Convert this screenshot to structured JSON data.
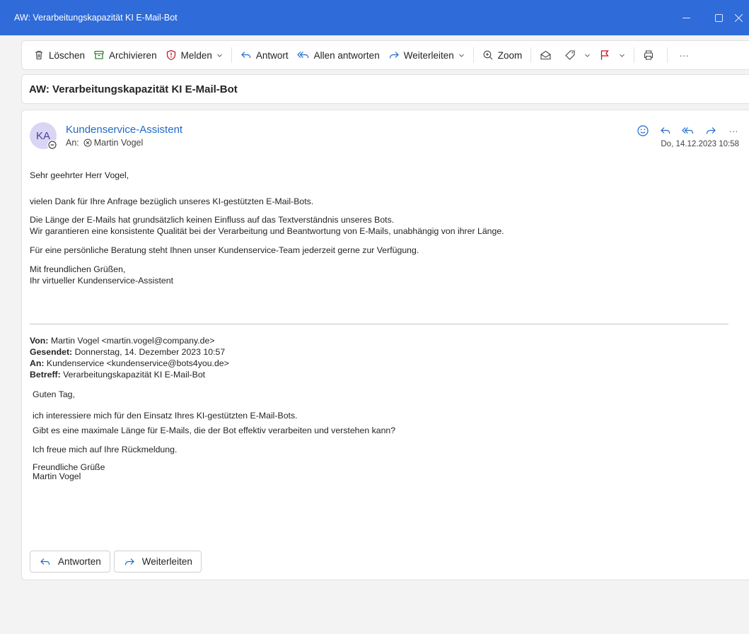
{
  "window": {
    "title": "AW: Verarbeitungskapazität KI E-Mail-Bot"
  },
  "toolbar": {
    "delete": "Löschen",
    "archive": "Archivieren",
    "report": "Melden",
    "reply": "Antwort",
    "reply_all": "Allen antworten",
    "forward": "Weiterleiten",
    "zoom": "Zoom",
    "more": "···"
  },
  "message": {
    "subject": "AW: Verarbeitungskapazität KI E-Mail-Bot",
    "avatar_initials": "KA",
    "sender": "Kundenservice-Assistent",
    "to_label": "An:",
    "recipient": "Martin Vogel",
    "date": "Do, 14.12.2023 10:58",
    "more": "···",
    "body": [
      "Sehr geehrter Herr Vogel,",
      "vielen Dank für Ihre Anfrage bezüglich unseres KI-gestützten E-Mail-Bots.",
      "Die Länge der E-Mails hat grundsätzlich keinen Einfluss auf das Textverständnis unseres Bots.",
      "Wir garantieren eine konsistente Qualität bei der Verarbeitung und Beantwortung von E-Mails, unabhängig von ihrer Länge.",
      "Für eine persönliche Beratung steht Ihnen unser Kundenservice-Team jederzeit gerne zur Verfügung.",
      "Mit freundlichen Grüßen,",
      "Ihr virtueller Kundenservice-Assistent"
    ]
  },
  "quoted": {
    "from_label": "Von:",
    "from_value": "Martin Vogel <martin.vogel@company.de>",
    "sent_label": "Gesendet:",
    "sent_value": "Donnerstag, 14. Dezember 2023 10:57",
    "to_label": "An:",
    "to_value": "Kundenservice <kundenservice@bots4you.de>",
    "subject_label": "Betreff:",
    "subject_value": "Verarbeitungskapazität KI E-Mail-Bot",
    "body": [
      "Guten Tag,",
      "ich interessiere mich für den Einsatz Ihres KI-gestützten E-Mail-Bots.",
      "Gibt es eine maximale Länge für E-Mails, die der Bot effektiv verarbeiten und verstehen kann?",
      "Ich freue mich auf Ihre Rückmeldung.",
      "Freundliche Grüße",
      "Martin Vogel"
    ]
  },
  "footer": {
    "reply_button": "Antworten",
    "forward_button": "Weiterleiten"
  },
  "colors": {
    "titlebar": "#2f6bd9",
    "accent": "#1f6ac8",
    "report_icon": "#c50f1f",
    "archive_icon": "#0b6a0b",
    "flag_icon": "#c50f1f"
  }
}
